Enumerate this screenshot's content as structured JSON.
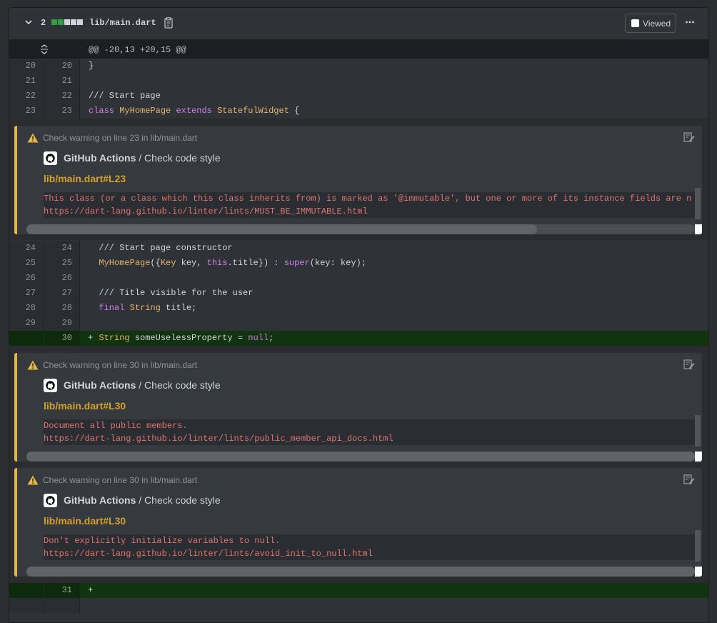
{
  "file": {
    "diff_count": "2",
    "diffstat": [
      "add",
      "add",
      "neutral",
      "neutral",
      "neutral"
    ],
    "filename": "lib/main.dart",
    "viewed_label": "Viewed"
  },
  "hunk": {
    "header": "@@ -20,13 +20,15 @@"
  },
  "lines_top": [
    {
      "old": "20",
      "new": "20",
      "code": "}"
    },
    {
      "old": "21",
      "new": "21",
      "code": ""
    },
    {
      "old": "22",
      "new": "22",
      "code": "/// Start page"
    },
    {
      "old": "23",
      "new": "23",
      "code": "class MyHomePage extends StatefulWidget {"
    }
  ],
  "lines_mid": [
    {
      "old": "24",
      "new": "24",
      "code": "  /// Start page constructor"
    },
    {
      "old": "25",
      "new": "25",
      "code": "  MyHomePage({Key key, this.title}) : super(key: key);"
    },
    {
      "old": "26",
      "new": "26",
      "code": ""
    },
    {
      "old": "27",
      "new": "27",
      "code": "  /// Title visible for the user"
    },
    {
      "old": "28",
      "new": "28",
      "code": "  final String title;"
    },
    {
      "old": "29",
      "new": "29",
      "code": ""
    }
  ],
  "line_added_30": {
    "old": "",
    "new": "30",
    "mark": "+",
    "code": "  String someUselessProperty = null;"
  },
  "line_added_31": {
    "old": "",
    "new": "31",
    "mark": "+",
    "code": ""
  },
  "annotations": [
    {
      "title": "Check warning on line 23 in lib/main.dart",
      "app": "GitHub Actions",
      "check": " / Check code style",
      "link": "lib/main.dart#L23",
      "message": [
        "This class (or a class which this class inherits from) is marked as '@immutable', but one or more of its instance fields are n",
        "https://dart-lang.github.io/linter/lints/MUST_BE_IMMUTABLE.html"
      ]
    },
    {
      "title": "Check warning on line 30 in lib/main.dart",
      "app": "GitHub Actions",
      "check": " / Check code style",
      "link": "lib/main.dart#L30",
      "message": [
        "Document all public members.",
        "https://dart-lang.github.io/linter/lints/public_member_api_docs.html"
      ]
    },
    {
      "title": "Check warning on line 30 in lib/main.dart",
      "app": "GitHub Actions",
      "check": " / Check code style",
      "link": "lib/main.dart#L30",
      "message": [
        "Don't explicitly initialize variables to null.",
        "https://dart-lang.github.io/linter/lints/avoid_init_to_null.html"
      ]
    }
  ],
  "colors": {
    "warning_accent": "#e5b545",
    "link": "#d4a02c",
    "message_text": "#e0736f",
    "added_row": "#12330f",
    "diffstat_add": "#2ea043"
  }
}
